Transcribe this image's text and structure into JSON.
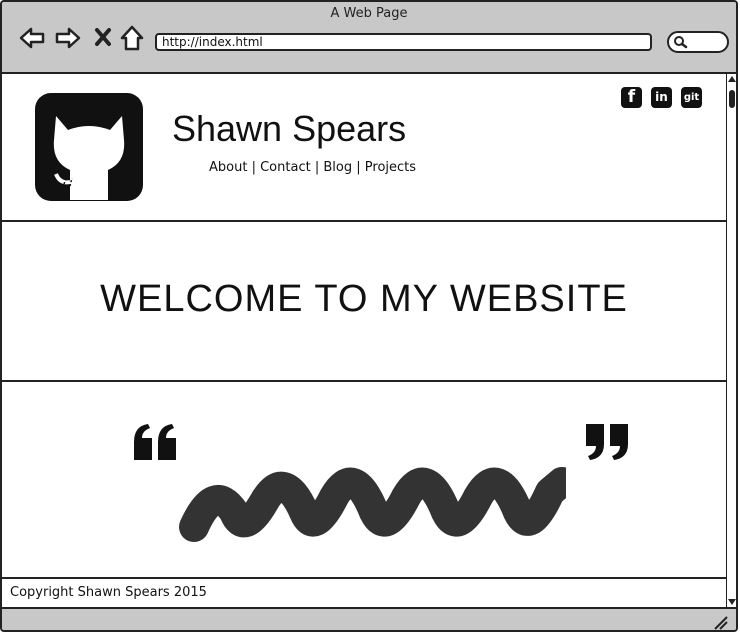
{
  "window": {
    "title": "A Web Page"
  },
  "browser": {
    "url": "http://index.html"
  },
  "header": {
    "site_name": "Shawn Spears",
    "nav": {
      "about": "About",
      "contact": "Contact",
      "blog": "Blog",
      "projects": "Projects",
      "separator": "|"
    },
    "social": {
      "facebook": "f",
      "linkedin": "in",
      "github": "git"
    }
  },
  "hero": {
    "heading": "WELCOME TO MY WEBSITE"
  },
  "footer": {
    "copyright": "Copyright Shawn Spears 2015"
  },
  "icons": [
    "back-arrow-icon",
    "forward-arrow-icon",
    "close-icon",
    "home-icon",
    "search-icon",
    "github-logo-icon",
    "facebook-icon",
    "linkedin-icon",
    "github-icon",
    "open-quote-icon",
    "close-quote-icon",
    "resize-grip-icon"
  ],
  "colors": {
    "chrome": "#c8c8c8",
    "ink": "#111111",
    "scribble": "#333333"
  }
}
